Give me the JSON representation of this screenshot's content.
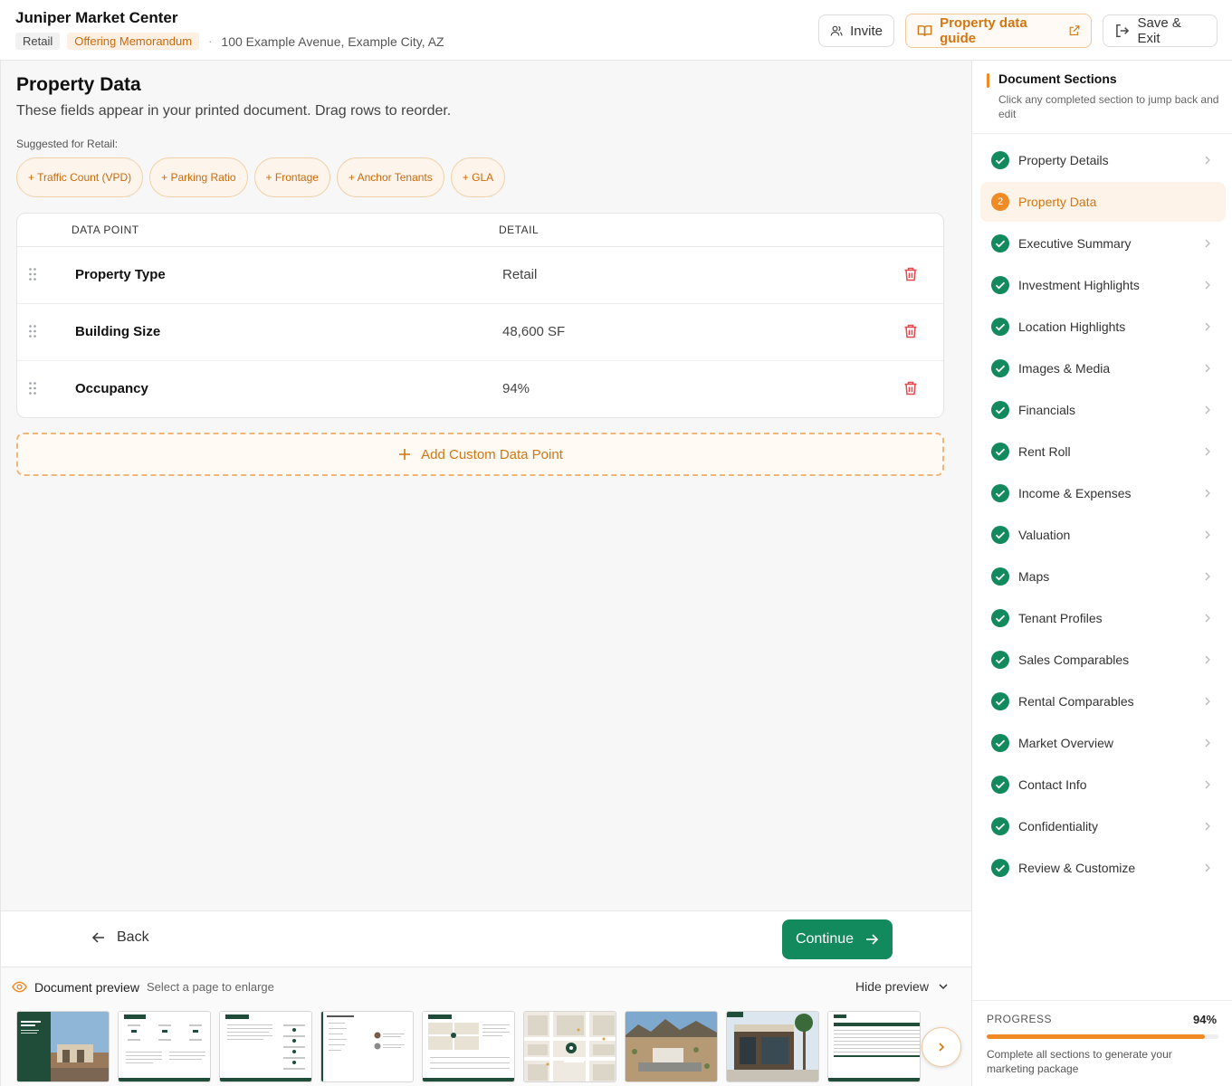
{
  "header": {
    "title": "Juniper Market Center",
    "tags": [
      "Retail",
      "Offering Memorandum"
    ],
    "address": "100 Example Avenue, Example City, AZ",
    "invite_label": "Invite",
    "guide_label": "Property data guide",
    "save_label": "Save & Exit"
  },
  "main": {
    "title": "Property Data",
    "subtitle": "These fields appear in your printed document. Drag rows to reorder.",
    "suggest_label": "Suggested for Retail:",
    "suggestions": [
      "+ Traffic Count (VPD)",
      "+ Parking Ratio",
      "+ Frontage",
      "+ Anchor Tenants",
      "+ GLA"
    ],
    "table": {
      "headers": {
        "point": "DATA POINT",
        "detail": "DETAIL"
      },
      "rows": [
        {
          "point": "Property Type",
          "detail": "Retail"
        },
        {
          "point": "Building Size",
          "detail": "48,600 SF"
        },
        {
          "point": "Occupancy",
          "detail": "94%"
        }
      ]
    },
    "add_custom_label": "Add Custom Data Point"
  },
  "footer": {
    "back_label": "Back",
    "continue_label": "Continue"
  },
  "preview": {
    "title": "Document preview",
    "hint": "Select a page to enlarge",
    "hide_label": "Hide preview"
  },
  "sidebar": {
    "title": "Document Sections",
    "subtitle": "Click any completed section to jump back and edit",
    "active_number": "2",
    "items": [
      {
        "label": "Property Details",
        "state": "done"
      },
      {
        "label": "Property Data",
        "state": "active"
      },
      {
        "label": "Executive Summary",
        "state": "done"
      },
      {
        "label": "Investment Highlights",
        "state": "done"
      },
      {
        "label": "Location Highlights",
        "state": "done"
      },
      {
        "label": "Images & Media",
        "state": "done"
      },
      {
        "label": "Financials",
        "state": "done"
      },
      {
        "label": "Rent Roll",
        "state": "done"
      },
      {
        "label": "Income & Expenses",
        "state": "done"
      },
      {
        "label": "Valuation",
        "state": "done"
      },
      {
        "label": "Maps",
        "state": "done"
      },
      {
        "label": "Tenant Profiles",
        "state": "done"
      },
      {
        "label": "Sales Comparables",
        "state": "done"
      },
      {
        "label": "Rental Comparables",
        "state": "done"
      },
      {
        "label": "Market Overview",
        "state": "done"
      },
      {
        "label": "Contact Info",
        "state": "done"
      },
      {
        "label": "Confidentiality",
        "state": "done"
      },
      {
        "label": "Review & Customize",
        "state": "done"
      }
    ],
    "progress_label": "PROGRESS",
    "progress_value": "94%",
    "progress_fraction": 0.94,
    "progress_note": "Complete all sections to generate your marketing package"
  },
  "colors": {
    "accent": "#f08a24",
    "accent_text": "#d27612",
    "success": "#128a5e",
    "danger": "#e5484d"
  }
}
